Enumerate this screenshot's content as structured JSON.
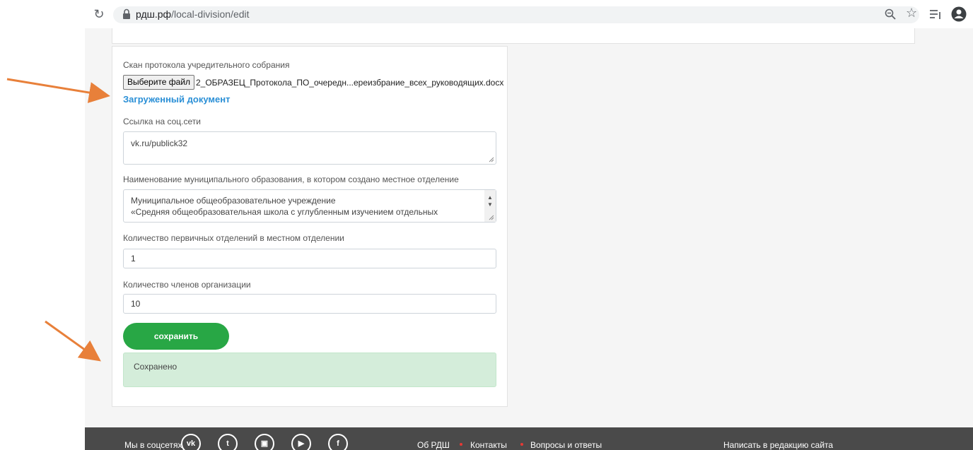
{
  "browser": {
    "url_host": "рдш.рф",
    "url_path": "/local-division/edit"
  },
  "form": {
    "scan_label": "Скан протокола учредительного собрания",
    "file_button_label": "Выберите файл",
    "file_name": "2_ОБРАЗЕЦ_Протокола_ПО_очередн...ереизбрание_всех_руководящих.docx",
    "uploaded_doc_link": "Загруженный документ",
    "social_label": "Ссылка на соц.сети",
    "social_value": "vk.ru/publick32",
    "municipality_label": "Наименование муниципального образования, в котором создано местное отделение",
    "municipality_line1": "Муниципальное общеобразовательное учреждение",
    "municipality_line2": "«Средняя общеобразовательная школа с углубленным изучением отдельных",
    "primary_count_label": "Количество первичных отделений в местном отделении",
    "primary_count_value": "1",
    "members_label": "Количество членов организации",
    "members_value": "10",
    "save_label": "сохранить",
    "saved_message": "Сохранено"
  },
  "footer": {
    "social_label": "Мы в соцсетях",
    "social_icons": [
      "vk-icon",
      "twitter-icon",
      "instagram-icon",
      "youtube-icon",
      "facebook-icon"
    ],
    "links": [
      "Об РДШ",
      "Контакты",
      "Вопросы и ответы"
    ],
    "write_editor": "Написать в редакцию сайта"
  },
  "colors": {
    "accent_blue": "#2a8fd6",
    "save_green": "#28a745",
    "success_bg": "#d4edda",
    "footer_bg": "#4a4a4a",
    "arrow_orange": "#e8803a"
  }
}
